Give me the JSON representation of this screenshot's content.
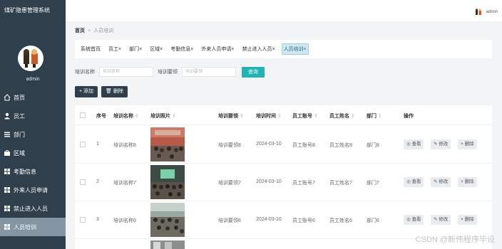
{
  "app": {
    "title": "煤矿隐患管理系统"
  },
  "user": {
    "name": "admin",
    "top_name": "admin"
  },
  "sidebar": {
    "items": [
      {
        "label": "首页",
        "icon": "home-icon"
      },
      {
        "label": "员工",
        "icon": "user-icon"
      },
      {
        "label": "部门",
        "icon": "list-icon"
      },
      {
        "label": "区域",
        "icon": "briefcase-icon"
      },
      {
        "label": "考勤信息",
        "icon": "grid-icon"
      },
      {
        "label": "外来人员申请",
        "icon": "grid-icon"
      },
      {
        "label": "禁止进入人员",
        "icon": "grid-icon"
      },
      {
        "label": "人员培训",
        "icon": "grid-icon",
        "active": true
      }
    ]
  },
  "breadcrumb": {
    "home": "首页",
    "current": "人员培训"
  },
  "tags": [
    {
      "label": "系统首页"
    },
    {
      "label": "员工×"
    },
    {
      "label": "部门×"
    },
    {
      "label": "区域×"
    },
    {
      "label": "考勤信息×"
    },
    {
      "label": "外来人员申请×"
    },
    {
      "label": "禁止进入人员×"
    },
    {
      "label": "人员培训×",
      "active": true
    }
  ],
  "search": {
    "name_label": "培训名称",
    "name_placeholder": "培训名称",
    "req_label": "培训要领",
    "req_placeholder": "培训要领",
    "query_button": "查询"
  },
  "toolbar": {
    "add_label": "+ 添加",
    "delete_label": "🗑 删除"
  },
  "table": {
    "columns": [
      "序号",
      "培训名称",
      "培训照片",
      "培训要领",
      "培训时间",
      "员工账号",
      "员工姓名",
      "部门",
      "操作"
    ],
    "sort_glyph": "⇕",
    "rows": [
      {
        "index": "1",
        "name": "培训名称8",
        "requirement": "培训要领8",
        "time": "2024-03-10",
        "account": "员工账号8",
        "staff": "员工姓名8",
        "dept": "部门8"
      },
      {
        "index": "2",
        "name": "培训名称7",
        "requirement": "培训要领7",
        "time": "2024-03-10",
        "account": "员工账号7",
        "staff": "员工姓名7",
        "dept": "部门7"
      },
      {
        "index": "3",
        "name": "培训名称6",
        "requirement": "培训要领6",
        "time": "2024-03-10",
        "account": "员工账号6",
        "staff": "员工姓名6",
        "dept": "部门6"
      }
    ],
    "ops": {
      "view": "◎ 查看",
      "edit": "✎ 修改",
      "delete": "× 删除"
    }
  },
  "watermark": "CSDN @新伟程序毕设",
  "colors": {
    "sidebar": "#2f3f4c",
    "accent": "#22b4b4",
    "active_menu": "#8496a3"
  }
}
